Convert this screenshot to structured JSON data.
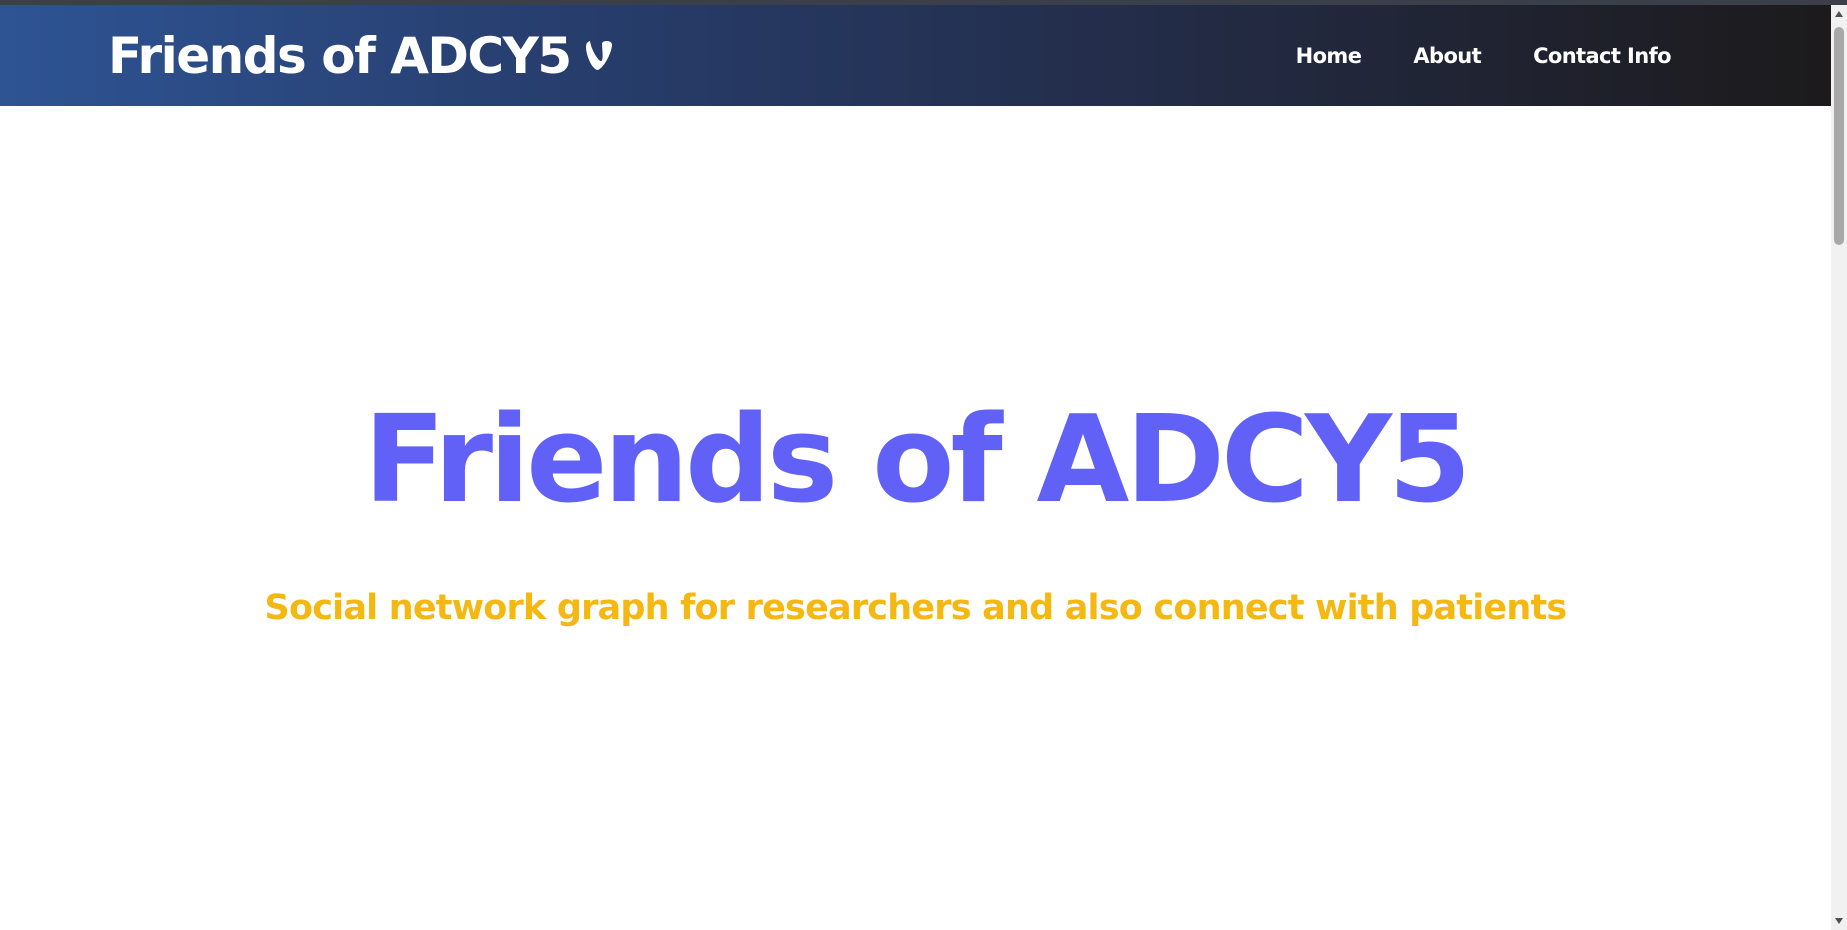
{
  "header": {
    "brand": "Friends of ADCY5",
    "logo_icon": "typo3-icon",
    "nav": [
      {
        "label": "Home"
      },
      {
        "label": "About"
      },
      {
        "label": "Contact Info"
      }
    ]
  },
  "hero": {
    "title": "Friends of ADCY5",
    "subtitle": "Social network graph for researchers and also connect with patients"
  },
  "colors": {
    "navbar_gradient_start": "#2e5494",
    "navbar_gradient_end": "#1c1a1b",
    "title": "#6161f7",
    "subtitle": "#f5b711"
  }
}
